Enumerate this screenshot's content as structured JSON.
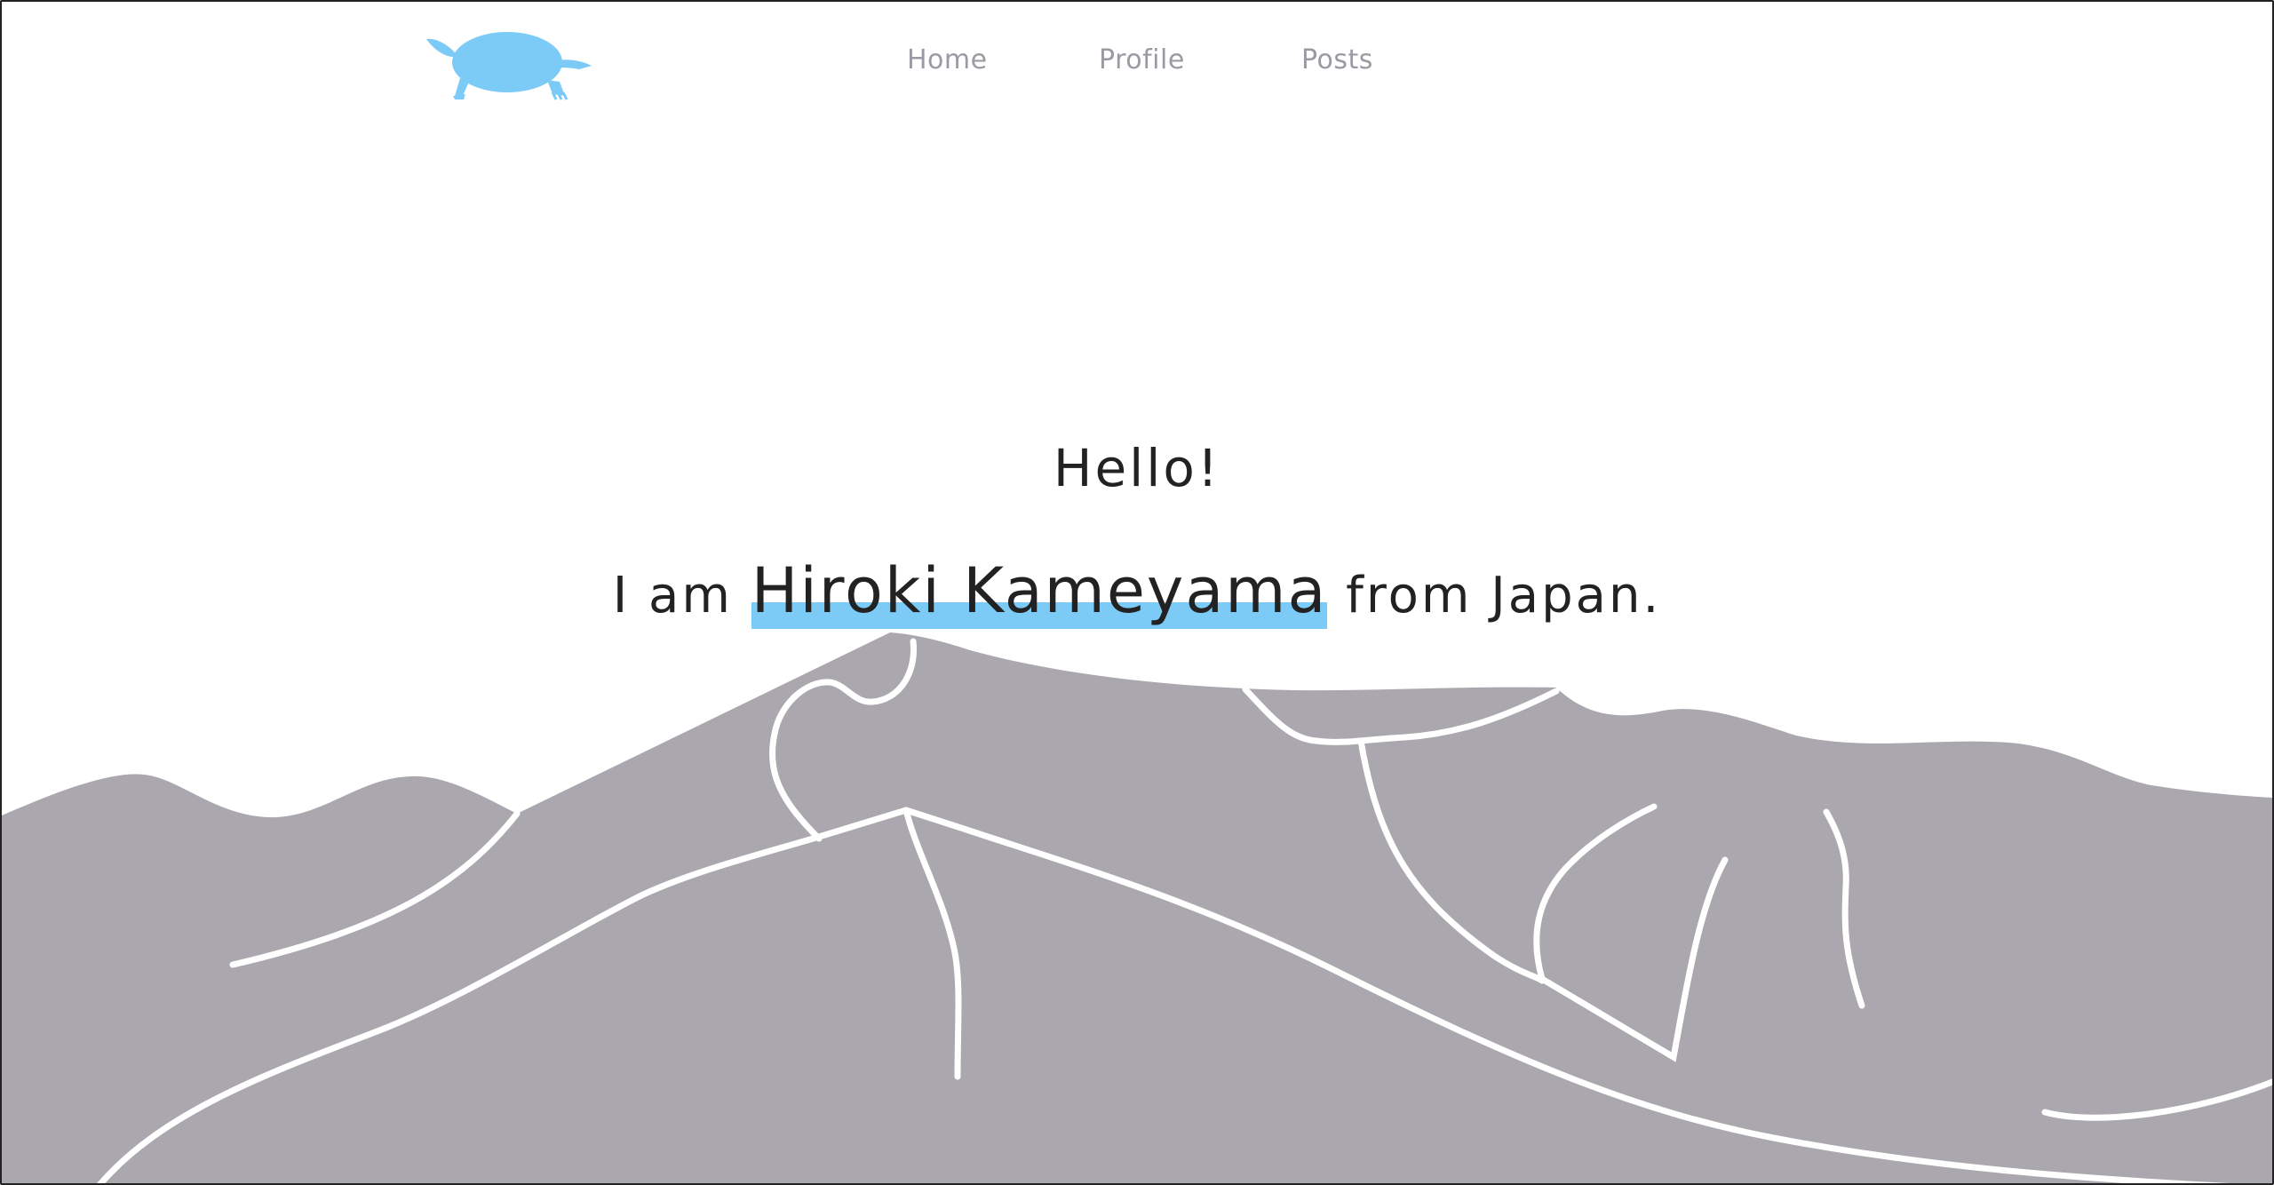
{
  "nav": {
    "items": [
      {
        "label": "Home"
      },
      {
        "label": "Profile"
      },
      {
        "label": "Posts"
      }
    ]
  },
  "hero": {
    "greeting": "Hello!",
    "intro_prefix": "I am ",
    "name": "Hiroki Kameyama",
    "intro_suffix": " from Japan."
  },
  "colors": {
    "accent": "#7ccbf7",
    "mountain": "#aba7ae",
    "nav_text": "#9a9aa3",
    "text": "#222222"
  },
  "icons": {
    "logo": "turtle-logo-icon",
    "illustration": "mountain-illustration"
  }
}
